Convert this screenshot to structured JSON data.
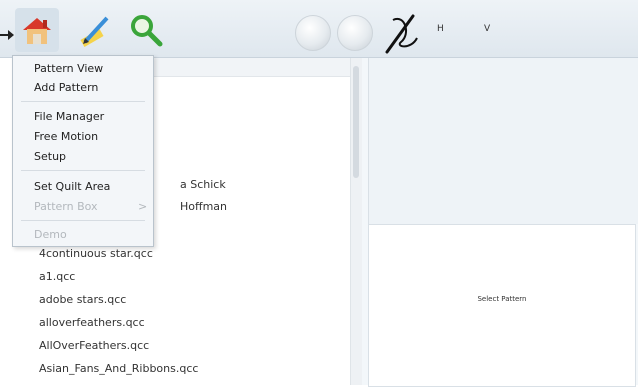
{
  "toolbar": {
    "h_label": "H",
    "v_label": "V",
    "icons": [
      "home-icon",
      "pencil-ruler-icon",
      "magnifier-icon",
      "circle-button-icon",
      "circle-button-icon",
      "needle-thread-icon"
    ]
  },
  "menu": {
    "items": [
      {
        "label": "Pattern View",
        "enabled": true
      },
      {
        "label": "Add Pattern",
        "enabled": true
      },
      {
        "label": "File Manager",
        "enabled": true
      },
      {
        "label": "Free Motion",
        "enabled": true
      },
      {
        "label": "Setup",
        "enabled": true
      },
      {
        "label": "Set Quilt Area",
        "enabled": true
      },
      {
        "label": "Pattern Box",
        "enabled": false,
        "submenu": true
      },
      {
        "label": "Demo",
        "enabled": false
      }
    ],
    "chevron": ">"
  },
  "list": {
    "partial_rows": [
      "a Schick",
      "Hoffman"
    ],
    "rows": [
      "4continuous star.qcc",
      "a1.qcc",
      "adobe stars.qcc",
      "alloverfeathers.qcc",
      "AllOverFeathers.qcc",
      "Asian_Fans_And_Ribbons.qcc"
    ]
  },
  "preview": {
    "label": "Select Pattern"
  },
  "colors": {
    "toolbar_bg": "#e6edf3",
    "menu_bg": "#f3f6f9",
    "disabled_text": "#b3b8bd"
  }
}
